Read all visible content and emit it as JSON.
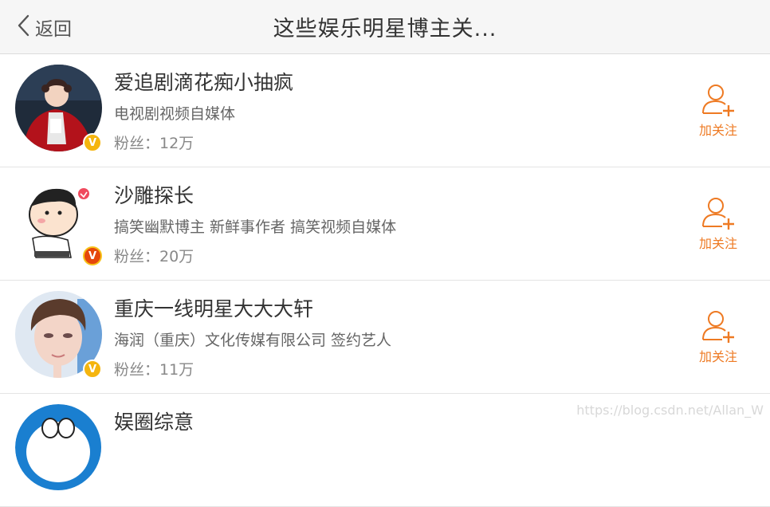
{
  "header": {
    "back_label": "返回",
    "title": "这些娱乐明星博主关..."
  },
  "follow_label": "加关注",
  "users": [
    {
      "name": "爱追剧滴花痴小抽疯",
      "desc": "电视剧视频自媒体",
      "fans": "粉丝：12万",
      "badge": "V"
    },
    {
      "name": "沙雕探长",
      "desc": "搞笑幽默博主 新鲜事作者 搞笑视频自媒体",
      "fans": "粉丝：20万",
      "badge": "V"
    },
    {
      "name": "重庆一线明星大大大轩",
      "desc": "海润（重庆）文化传媒有限公司 签约艺人",
      "fans": "粉丝：11万",
      "badge": "V"
    },
    {
      "name": "娱圈综意"
    }
  ],
  "watermark": "https://blog.csdn.net/Allan_W",
  "colors": {
    "accent": "#ee7a23",
    "badge_gold": "#f5b50f",
    "badge_red": "#e5470c"
  }
}
